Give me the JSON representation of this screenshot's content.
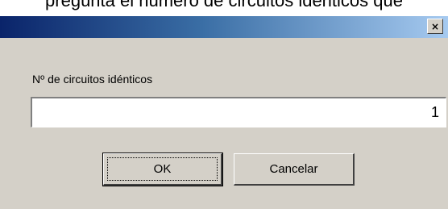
{
  "caption": {
    "text": "pregunta el número de circuitos idénticos que"
  },
  "titlebar": {
    "close_symbol": "×",
    "gradient_start": "#0a246a",
    "gradient_end": "#a6caf0"
  },
  "dialog": {
    "prompt_label": "Nº de circuitos idénticos",
    "field_value": "1",
    "ok_label": "OK",
    "cancel_label": "Cancelar",
    "face_color": "#d4d0c8"
  }
}
